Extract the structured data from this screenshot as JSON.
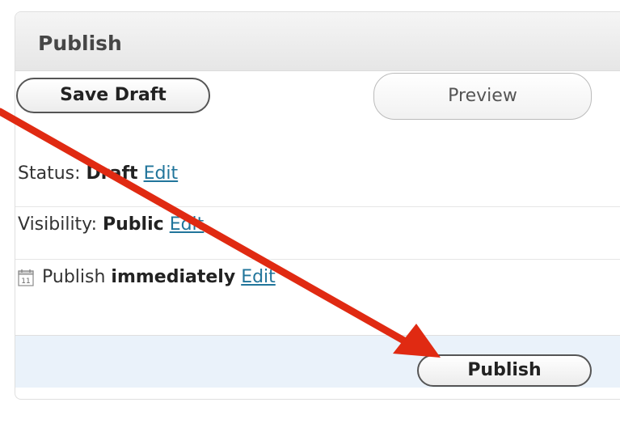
{
  "box": {
    "title": "Publish"
  },
  "actions": {
    "save_draft_label": "Save Draft",
    "preview_label": "Preview",
    "publish_label": "Publish"
  },
  "status": {
    "label": "Status:",
    "value": "Draft",
    "edit_label": "Edit"
  },
  "visibility": {
    "label": "Visibility:",
    "value": "Public",
    "edit_label": "Edit"
  },
  "schedule": {
    "label": "Publish",
    "value": "immediately",
    "edit_label": "Edit",
    "calendar_day": "11",
    "icon": "calendar-icon"
  },
  "colors": {
    "link": "#21759b",
    "annotation_arrow": "#e02a12",
    "footer_bg": "#eaf2fa"
  }
}
